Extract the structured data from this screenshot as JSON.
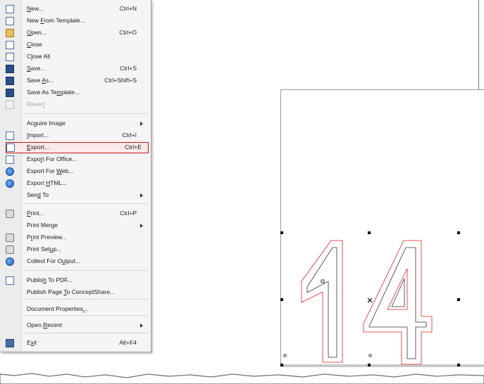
{
  "menu": {
    "items": [
      {
        "label_pre": "",
        "label_u": "N",
        "label_post": "ew...",
        "shortcut": "Ctrl+N",
        "icon": "new-document-icon"
      },
      {
        "label_pre": "New ",
        "label_u": "F",
        "label_post": "rom Template...",
        "shortcut": "",
        "icon": "new-from-template-icon"
      },
      {
        "label_pre": "",
        "label_u": "O",
        "label_post": "pen...",
        "shortcut": "Ctrl+O",
        "icon": "open-folder-icon"
      },
      {
        "label_pre": "",
        "label_u": "C",
        "label_post": "lose",
        "shortcut": "",
        "icon": "close-document-icon"
      },
      {
        "label_pre": "C",
        "label_u": "l",
        "label_post": "ose All",
        "shortcut": "",
        "icon": "close-all-icon"
      },
      {
        "label_pre": "",
        "label_u": "S",
        "label_post": "ave...",
        "shortcut": "Ctrl+S",
        "icon": "save-icon"
      },
      {
        "label_pre": "Save ",
        "label_u": "A",
        "label_post": "s...",
        "shortcut": "Ctrl+Shift+S",
        "icon": "save-as-icon"
      },
      {
        "label_pre": "Save As Te",
        "label_u": "m",
        "label_post": "plate...",
        "shortcut": "",
        "icon": "save-as-template-icon"
      },
      {
        "label_pre": "Rever",
        "label_u": "t",
        "label_post": "",
        "shortcut": "",
        "icon": "revert-icon",
        "disabled": true
      },
      {
        "label_pre": "Ac",
        "label_u": "q",
        "label_post": "uire Image",
        "shortcut": "",
        "icon": "",
        "submenu": true
      },
      {
        "label_pre": "",
        "label_u": "I",
        "label_post": "mport...",
        "shortcut": "Ctrl+I",
        "icon": "import-icon"
      },
      {
        "label_pre": "",
        "label_u": "E",
        "label_post": "xport...",
        "shortcut": "Ctrl+E",
        "icon": "export-icon",
        "highlight": true
      },
      {
        "label_pre": "Expo",
        "label_u": "r",
        "label_post": "t For Office...",
        "shortcut": "",
        "icon": "export-for-office-icon"
      },
      {
        "label_pre": "Export For ",
        "label_u": "W",
        "label_post": "eb...",
        "shortcut": "",
        "icon": "export-for-web-icon"
      },
      {
        "label_pre": "Export ",
        "label_u": "H",
        "label_post": "TML...",
        "shortcut": "",
        "icon": "export-html-icon"
      },
      {
        "label_pre": "Sen",
        "label_u": "d",
        "label_post": " To",
        "shortcut": "",
        "icon": "",
        "submenu": true
      },
      {
        "label_pre": "",
        "label_u": "P",
        "label_post": "rint...",
        "shortcut": "Ctrl+P",
        "icon": "print-icon"
      },
      {
        "label_pre": "Print Mer",
        "label_u": "g",
        "label_post": "e",
        "shortcut": "",
        "icon": "",
        "submenu": true
      },
      {
        "label_pre": "P",
        "label_u": "r",
        "label_post": "int Preview...",
        "shortcut": "",
        "icon": "print-preview-icon"
      },
      {
        "label_pre": "Print Set",
        "label_u": "u",
        "label_post": "p...",
        "shortcut": "",
        "icon": "print-setup-icon"
      },
      {
        "label_pre": "Collect For O",
        "label_u": "u",
        "label_post": "tput...",
        "shortcut": "",
        "icon": "collect-for-output-icon"
      },
      {
        "label_pre": "Publis",
        "label_u": "h",
        "label_post": " To PDF...",
        "shortcut": "",
        "icon": "publish-pdf-icon"
      },
      {
        "label_pre": "Publish Page ",
        "label_u": "T",
        "label_post": "o ConceptShare...",
        "shortcut": "",
        "icon": ""
      },
      {
        "label_pre": "Document Properties",
        "label_u": ".",
        "label_post": "..",
        "shortcut": "",
        "icon": ""
      },
      {
        "label_pre": "Open ",
        "label_u": "R",
        "label_post": "ecent",
        "shortcut": "",
        "icon": "",
        "submenu": true
      },
      {
        "label_pre": "E",
        "label_u": "x",
        "label_post": "it",
        "shortcut": "Alt+F4",
        "icon": "exit-icon"
      }
    ]
  },
  "canvas": {
    "artwork_text": "14"
  },
  "colors": {
    "highlight_border": "#c01a1a",
    "outline_red": "#e02020"
  }
}
